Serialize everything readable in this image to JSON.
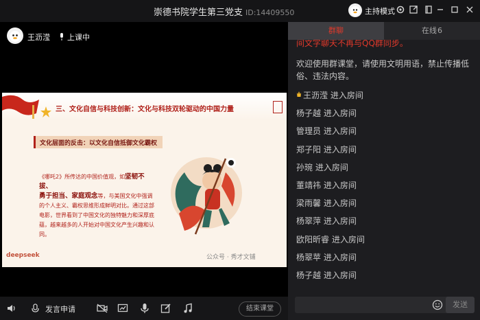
{
  "window": {
    "title": "崇德书院学生第三党支",
    "id_text": "ID:14409550",
    "host_mode_label": "主持模式"
  },
  "teacher": {
    "name": "王沥滢",
    "status": "上课中"
  },
  "slide": {
    "heading": "三、文化自信与科技创新：文化与科技双轮驱动的中国力量",
    "subheading": "文化层面的反击：以文化自信抵御文化霸权",
    "body": {
      "p1": "《哪吒2》所传达的中国价值观，如",
      "h1": "坚韧不拔、",
      "h2": "勇于担当、家庭观念",
      "p2": "等，与美国文化中强调的个人主义、霸权思维形成鲜明对比。通过这部电影，世界看到了中国文化的独特魅力和深厚底蕴，越来越多的人开始对中国文化产生兴趣和认同。"
    },
    "logo_text": "deepseek",
    "watermark": "公众号 · 秀才文铺"
  },
  "bottom": {
    "apply_label": "发言申请",
    "end_label": "结束课堂"
  },
  "panel": {
    "tab_chat": "群聊",
    "tab_online": "在线",
    "online_count": "6",
    "msg_partial": "间文字聊天不再与QQ群同步。",
    "msg_notice": "欢迎使用群课堂，请使用文明用语，禁止传播低俗、违法内容。",
    "join_suffix": "进入房间",
    "joins": [
      "王沥滢",
      "杨子越",
      "管理员",
      "郑子阳",
      "孙琬",
      "董靖祎",
      "梁雨馨",
      "杨翠萍",
      "欧阳昕睿",
      "杨翠苹",
      "杨子越"
    ],
    "send_label": "发送",
    "input_placeholder": ""
  },
  "colors": {
    "accent_red": "#e0392b",
    "slide_red": "#b0211a"
  }
}
